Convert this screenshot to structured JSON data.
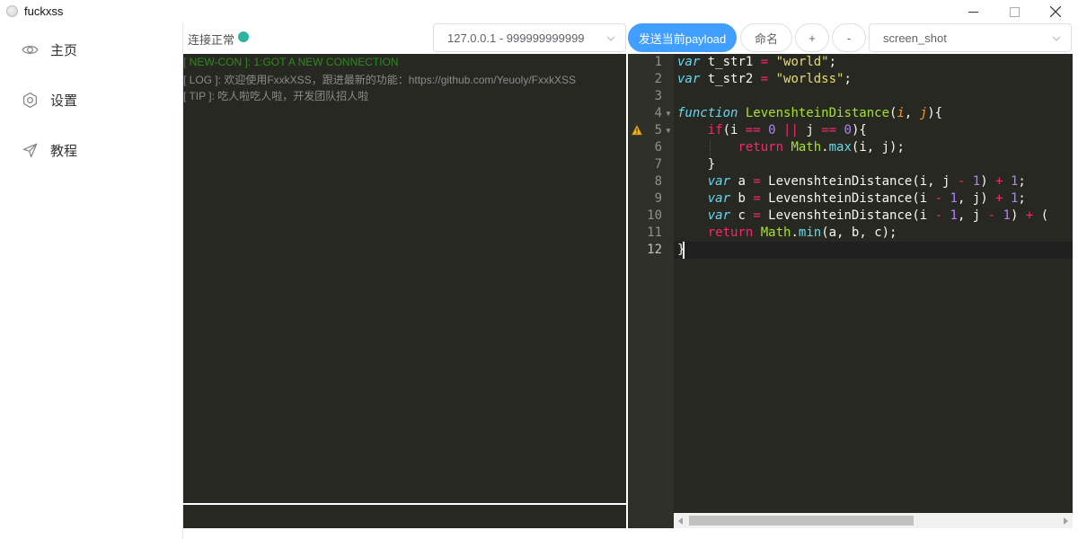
{
  "window": {
    "title": "fuckxss",
    "minimize": "—",
    "maximize": "☐",
    "close": "✕"
  },
  "sidebar": {
    "items": [
      {
        "label": "主页",
        "icon": "eye-icon"
      },
      {
        "label": "设置",
        "icon": "gear-icon"
      },
      {
        "label": "教程",
        "icon": "send-icon"
      }
    ]
  },
  "toolbar": {
    "status_text": "连接正常",
    "status_color": "#2bb5a0",
    "connection_value": "127.0.0.1 - 999999999999",
    "send_label": "发送当前payload",
    "name_label": "命名",
    "plus_label": "+",
    "minus_label": "-",
    "screen_value": "screen_shot",
    "accent_color": "#409eff"
  },
  "log": {
    "lines": [
      "[ NEW-CON ]: 1:GOT A NEW CONNECTION",
      "[ LOG ]: 欢迎使用FxxkXSS，跟进最新的功能：https://github.com/Yeuoly/FxxkXSS",
      "[ TIP ]: 吃人啦吃人啦，开发团队招人啦"
    ],
    "input_value": ""
  },
  "editor": {
    "line_numbers": [
      "1",
      "2",
      "3",
      "4",
      "5",
      "6",
      "7",
      "8",
      "9",
      "10",
      "11",
      "12"
    ],
    "active_line": "12",
    "warning_line": "5"
  }
}
